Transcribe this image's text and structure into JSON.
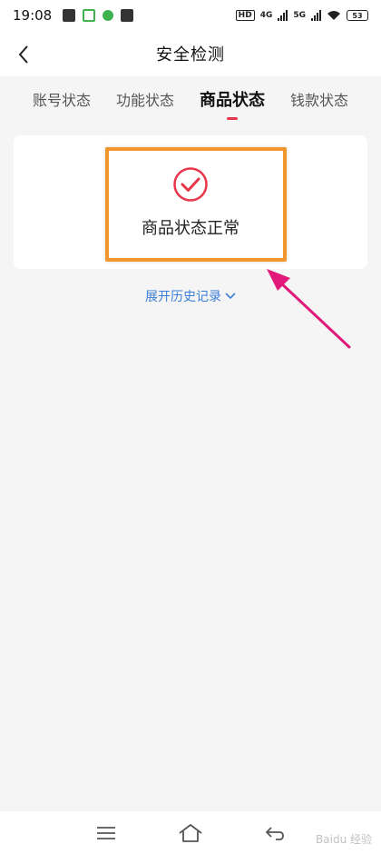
{
  "status_bar": {
    "time": "19:08",
    "network_left": "4G",
    "network_right": "5G",
    "hd_label": "HD",
    "battery": "53"
  },
  "header": {
    "title": "安全检测"
  },
  "tabs": [
    {
      "label": "账号状态",
      "active": false
    },
    {
      "label": "功能状态",
      "active": false
    },
    {
      "label": "商品状态",
      "active": true
    },
    {
      "label": "钱款状态",
      "active": false
    }
  ],
  "result": {
    "status_text": "商品状态正常",
    "icon": "check-circle-icon"
  },
  "expand": {
    "label": "展开历史记录"
  },
  "watermark": {
    "text": "Baidu 经验"
  },
  "colors": {
    "accent_red": "#e8354a",
    "link_blue": "#3a7fd5",
    "highlight_orange": "#f0962c",
    "annotation_pink": "#e0197a"
  }
}
